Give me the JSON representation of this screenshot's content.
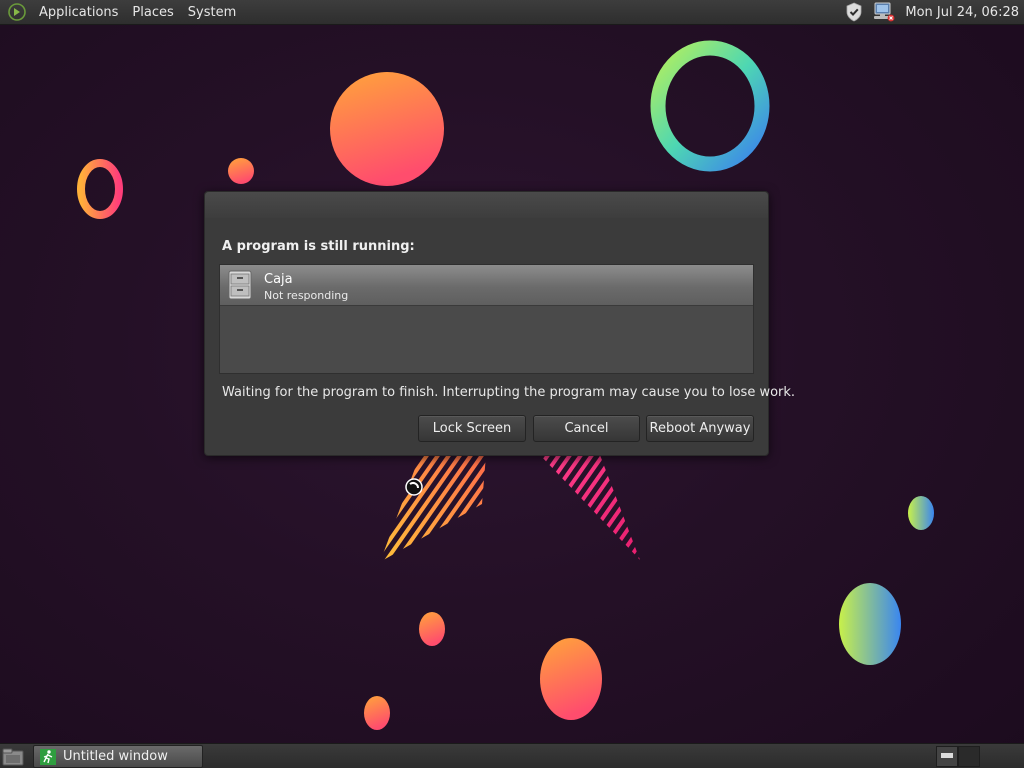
{
  "top_panel": {
    "menus": [
      "Applications",
      "Places",
      "System"
    ],
    "clock": "Mon Jul 24, 06:28",
    "tray_icons": [
      "shield-icon",
      "network-icon"
    ]
  },
  "dialog": {
    "heading": "A program is still running:",
    "programs": [
      {
        "name": "Caja",
        "status": "Not responding",
        "icon": "file-cabinet-icon"
      }
    ],
    "message": "Waiting for the program to finish.  Interrupting the program may cause you to lose work.",
    "buttons": {
      "lock": "Lock Screen",
      "cancel": "Cancel",
      "reboot": "Reboot Anyway"
    }
  },
  "bottom_panel": {
    "task": {
      "label": "Untitled window",
      "icon": "running-man-icon"
    },
    "workspaces": 2,
    "active_workspace": 1
  },
  "colors": {
    "background": "#241026",
    "panel": "#333333",
    "dialog": "#3b3b3b",
    "selection": "#7a7a7a"
  }
}
